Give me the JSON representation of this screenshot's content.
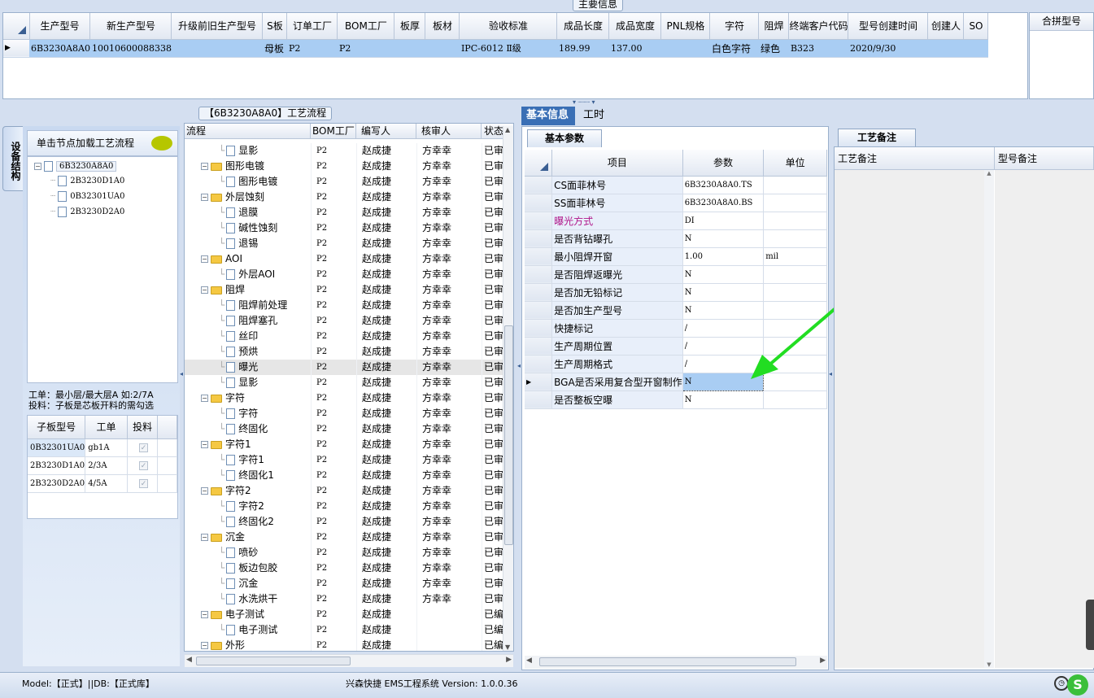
{
  "main_info_title": "主要信息",
  "top_grid": {
    "columns": [
      "生产型号",
      "新生产型号",
      "升级前旧生产型号",
      "S板",
      "订单工厂",
      "BOM工厂",
      "板厚",
      "板材",
      "验收标准",
      "成品长度",
      "成品宽度",
      "PNL规格",
      "字符",
      "阻焊",
      "终端客户代码",
      "型号创建时间",
      "创建人",
      "SO"
    ],
    "row": [
      "6B3230A8A0",
      "10010600088338",
      "",
      "母板",
      "P2",
      "P2",
      "",
      "",
      "IPC-6012 Ⅱ级",
      "189.99",
      "137.00",
      "",
      "白色字符",
      "绿色",
      "B323",
      "2020/9/30",
      "",
      ""
    ]
  },
  "merge_panel_title": "合拼型号",
  "left_panel": {
    "vertical_tab": "设备结构",
    "load_hint": "单击节点加载工艺流程",
    "tree_root": "6B3230A8A0",
    "tree_children": [
      "2B3230D1A0",
      "0B32301UA0",
      "2B3230D2A0"
    ],
    "note_line1": "工单：最小层/最大层A 如:2/7A",
    "note_line2": "投料：子板是芯板开料的需勾选",
    "sub_columns": [
      "子板型号",
      "工单",
      "投料"
    ],
    "sub_rows": [
      {
        "model": "0B32301UA0",
        "order": "gb1A",
        "checked": true
      },
      {
        "model": "2B3230D1A0",
        "order": "2/3A",
        "checked": true
      },
      {
        "model": "2B3230D2A0",
        "order": "4/5A",
        "checked": true
      }
    ]
  },
  "process": {
    "title": "【6B3230A8A0】工艺流程",
    "columns": [
      "流程",
      "BOM工厂",
      "编写人",
      "核审人",
      "状态"
    ],
    "rows": [
      {
        "name": "显影",
        "level": 2,
        "factory": "P2",
        "writer": "赵成捷",
        "reviewer": "方幸幸",
        "status": "已审"
      },
      {
        "name": "图形电镀",
        "level": 1,
        "factory": "P2",
        "writer": "赵成捷",
        "reviewer": "方幸幸",
        "status": "已审"
      },
      {
        "name": "图形电镀",
        "level": 2,
        "factory": "P2",
        "writer": "赵成捷",
        "reviewer": "方幸幸",
        "status": "已审"
      },
      {
        "name": "外层蚀刻",
        "level": 1,
        "factory": "P2",
        "writer": "赵成捷",
        "reviewer": "方幸幸",
        "status": "已审"
      },
      {
        "name": "退膜",
        "level": 2,
        "factory": "P2",
        "writer": "赵成捷",
        "reviewer": "方幸幸",
        "status": "已审"
      },
      {
        "name": "碱性蚀刻",
        "level": 2,
        "factory": "P2",
        "writer": "赵成捷",
        "reviewer": "方幸幸",
        "status": "已审"
      },
      {
        "name": "退锡",
        "level": 2,
        "factory": "P2",
        "writer": "赵成捷",
        "reviewer": "方幸幸",
        "status": "已审"
      },
      {
        "name": "AOI",
        "level": 1,
        "factory": "P2",
        "writer": "赵成捷",
        "reviewer": "方幸幸",
        "status": "已审"
      },
      {
        "name": "外层AOI",
        "level": 2,
        "factory": "P2",
        "writer": "赵成捷",
        "reviewer": "方幸幸",
        "status": "已审"
      },
      {
        "name": "阻焊",
        "level": 1,
        "factory": "P2",
        "writer": "赵成捷",
        "reviewer": "方幸幸",
        "status": "已审"
      },
      {
        "name": "阻焊前处理",
        "level": 2,
        "factory": "P2",
        "writer": "赵成捷",
        "reviewer": "方幸幸",
        "status": "已审"
      },
      {
        "name": "阻焊塞孔",
        "level": 2,
        "factory": "P2",
        "writer": "赵成捷",
        "reviewer": "方幸幸",
        "status": "已审"
      },
      {
        "name": "丝印",
        "level": 2,
        "factory": "P2",
        "writer": "赵成捷",
        "reviewer": "方幸幸",
        "status": "已审"
      },
      {
        "name": "预烘",
        "level": 2,
        "factory": "P2",
        "writer": "赵成捷",
        "reviewer": "方幸幸",
        "status": "已审"
      },
      {
        "name": "曝光",
        "level": 2,
        "factory": "P2",
        "writer": "赵成捷",
        "reviewer": "方幸幸",
        "status": "已审",
        "selected": true
      },
      {
        "name": "显影",
        "level": 2,
        "factory": "P2",
        "writer": "赵成捷",
        "reviewer": "方幸幸",
        "status": "已审"
      },
      {
        "name": "字符",
        "level": 1,
        "factory": "P2",
        "writer": "赵成捷",
        "reviewer": "方幸幸",
        "status": "已审"
      },
      {
        "name": "字符",
        "level": 2,
        "factory": "P2",
        "writer": "赵成捷",
        "reviewer": "方幸幸",
        "status": "已审"
      },
      {
        "name": "终固化",
        "level": 2,
        "factory": "P2",
        "writer": "赵成捷",
        "reviewer": "方幸幸",
        "status": "已审"
      },
      {
        "name": "字符1",
        "level": 1,
        "factory": "P2",
        "writer": "赵成捷",
        "reviewer": "方幸幸",
        "status": "已审"
      },
      {
        "name": "字符1",
        "level": 2,
        "factory": "P2",
        "writer": "赵成捷",
        "reviewer": "方幸幸",
        "status": "已审"
      },
      {
        "name": "终固化1",
        "level": 2,
        "factory": "P2",
        "writer": "赵成捷",
        "reviewer": "方幸幸",
        "status": "已审"
      },
      {
        "name": "字符2",
        "level": 1,
        "factory": "P2",
        "writer": "赵成捷",
        "reviewer": "方幸幸",
        "status": "已审"
      },
      {
        "name": "字符2",
        "level": 2,
        "factory": "P2",
        "writer": "赵成捷",
        "reviewer": "方幸幸",
        "status": "已审"
      },
      {
        "name": "终固化2",
        "level": 2,
        "factory": "P2",
        "writer": "赵成捷",
        "reviewer": "方幸幸",
        "status": "已审"
      },
      {
        "name": "沉金",
        "level": 1,
        "factory": "P2",
        "writer": "赵成捷",
        "reviewer": "方幸幸",
        "status": "已审"
      },
      {
        "name": "喷砂",
        "level": 2,
        "factory": "P2",
        "writer": "赵成捷",
        "reviewer": "方幸幸",
        "status": "已审"
      },
      {
        "name": "板边包胶",
        "level": 2,
        "factory": "P2",
        "writer": "赵成捷",
        "reviewer": "方幸幸",
        "status": "已审"
      },
      {
        "name": "沉金",
        "level": 2,
        "factory": "P2",
        "writer": "赵成捷",
        "reviewer": "方幸幸",
        "status": "已审"
      },
      {
        "name": "水洗烘干",
        "level": 2,
        "factory": "P2",
        "writer": "赵成捷",
        "reviewer": "方幸幸",
        "status": "已审"
      },
      {
        "name": "电子测试",
        "level": 1,
        "factory": "P2",
        "writer": "赵成捷",
        "reviewer": "",
        "status": "已编"
      },
      {
        "name": "电子测试",
        "level": 2,
        "factory": "P2",
        "writer": "赵成捷",
        "reviewer": "",
        "status": "已编"
      },
      {
        "name": "外形",
        "level": 1,
        "factory": "P2",
        "writer": "赵成捷",
        "reviewer": "",
        "status": "已编"
      }
    ]
  },
  "info": {
    "tabs": [
      "基本信息",
      "工时"
    ],
    "subtab": "基本参数",
    "columns": [
      "项目",
      "参数",
      "单位"
    ],
    "rows": [
      {
        "item": "CS面菲林号",
        "value": "6B3230A8A0.TS",
        "unit": ""
      },
      {
        "item": "SS面菲林号",
        "value": "6B3230A8A0.BS",
        "unit": ""
      },
      {
        "item": "曝光方式",
        "value": "DI",
        "unit": "",
        "highlight": true
      },
      {
        "item": "是否背钻曝孔",
        "value": "N",
        "unit": ""
      },
      {
        "item": "最小阻焊开窗",
        "value": "1.00",
        "unit": "mil"
      },
      {
        "item": "是否阻焊返曝光",
        "value": "N",
        "unit": ""
      },
      {
        "item": "是否加无铅标记",
        "value": "N",
        "unit": ""
      },
      {
        "item": "是否加生产型号",
        "value": "N",
        "unit": ""
      },
      {
        "item": "快捷标记",
        "value": "/",
        "unit": ""
      },
      {
        "item": "生产周期位置",
        "value": "/",
        "unit": ""
      },
      {
        "item": "生产周期格式",
        "value": "/",
        "unit": ""
      },
      {
        "item": "BGA是否采用复合型开窗制作",
        "value": "N",
        "unit": "",
        "selected": true
      },
      {
        "item": "是否整板空曝",
        "value": "N",
        "unit": ""
      }
    ],
    "highlight_color": "#b0168a"
  },
  "remarks": {
    "tab": "工艺备注",
    "col1": "工艺备注",
    "col2": "型号备注"
  },
  "status_bar": {
    "left": "Model:【正式】||DB:【正式库】",
    "center": "兴森快捷 EMS工程系统 Version: 1.0.0.36"
  },
  "colors": {
    "selection": "#a9cdf3",
    "accent_tab": "#3a6fb5",
    "arrow": "#22dd22"
  }
}
